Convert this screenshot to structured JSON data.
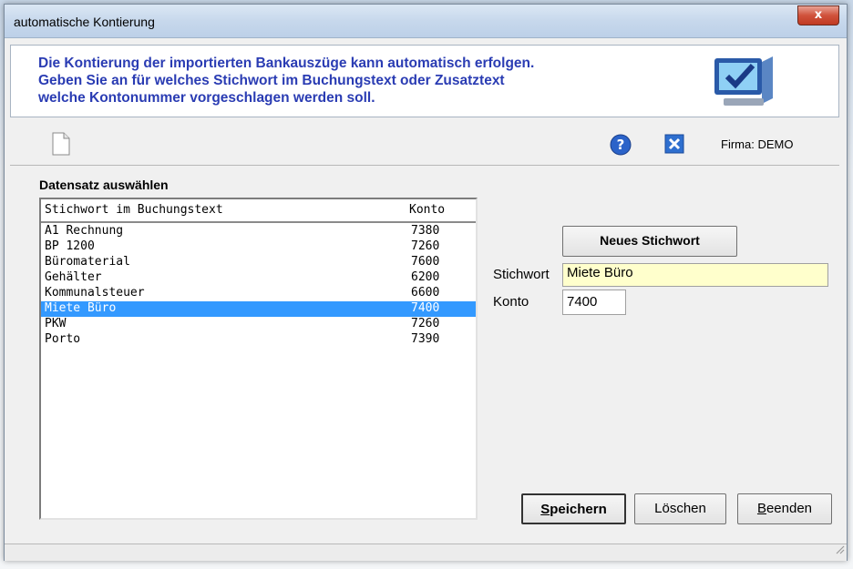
{
  "window": {
    "title": "automatische Kontierung",
    "close_label": "x"
  },
  "header": {
    "line1": "Die Kontierung der importierten Bankauszüge kann automatisch erfolgen.",
    "line2": "Geben Sie  an für welches Stichwort im Buchungstext oder Zusatztext",
    "line3": "welche Kontonummer vorgeschlagen werden soll."
  },
  "toolbar": {
    "firma": "Firma:  DEMO"
  },
  "list": {
    "section_title": "Datensatz auswählen",
    "col_stichwort": "Stichwort im Buchungstext",
    "col_konto": "Konto",
    "rows": [
      {
        "stichwort": "A1 Rechnung",
        "konto": "7380"
      },
      {
        "stichwort": "BP 1200",
        "konto": "7260"
      },
      {
        "stichwort": "Büromaterial",
        "konto": "7600"
      },
      {
        "stichwort": "Gehälter",
        "konto": "6200"
      },
      {
        "stichwort": "Kommunalsteuer",
        "konto": "6600"
      },
      {
        "stichwort": "Miete Büro",
        "konto": "7400"
      },
      {
        "stichwort": "PKW",
        "konto": "7260"
      },
      {
        "stichwort": "Porto",
        "konto": "7390"
      }
    ],
    "selected_index": 5
  },
  "form": {
    "neues_button": "Neues Stichwort",
    "stichwort_label": "Stichwort",
    "stichwort_value": "Miete Büro",
    "konto_label": "Konto",
    "konto_value": "7400"
  },
  "buttons": {
    "speichern_first": "S",
    "speichern_rest": "peichern",
    "loeschen": "Löschen",
    "beenden_first": "B",
    "beenden_rest": "eenden"
  },
  "colors": {
    "header_text": "#2a3cb3",
    "selection": "#3399ff",
    "stichwort_field": "#ffffcc"
  }
}
